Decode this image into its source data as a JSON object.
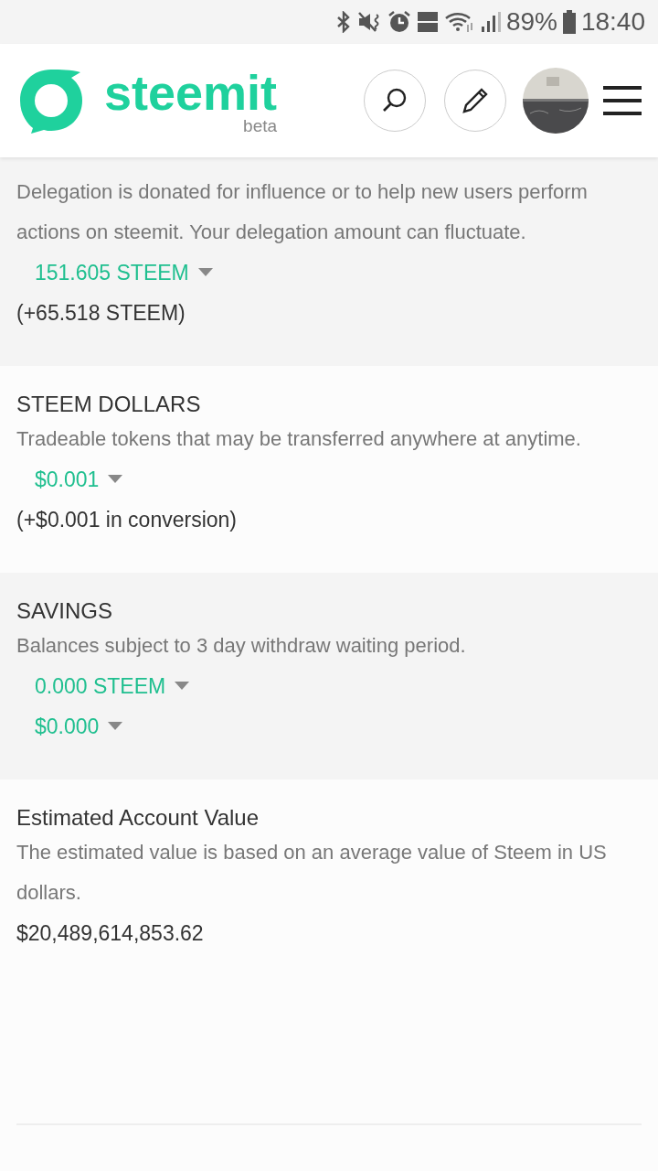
{
  "status_bar": {
    "battery": "89%",
    "time": "18:40"
  },
  "header": {
    "logo": "steemit",
    "logo_sub": "beta"
  },
  "sections": [
    {
      "description": "Delegation is donated for influence or to help new users perform actions on steemit. Your delegation amount can fluctuate.",
      "amounts": [
        "151.605 STEEM"
      ],
      "note": "(+65.518 STEEM)"
    },
    {
      "title": "STEEM DOLLARS",
      "description": "Tradeable tokens that may be transferred anywhere at anytime.",
      "amounts": [
        "$0.001"
      ],
      "note": "(+$0.001 in conversion)"
    },
    {
      "title": "SAVINGS",
      "description": "Balances subject to 3 day withdraw waiting period.",
      "amounts": [
        "0.000 STEEM",
        "$0.000"
      ]
    },
    {
      "title": "Estimated Account Value",
      "description": "The estimated value is based on an average value of Steem in US dollars.",
      "value": "$20,489,614,853.62"
    }
  ]
}
